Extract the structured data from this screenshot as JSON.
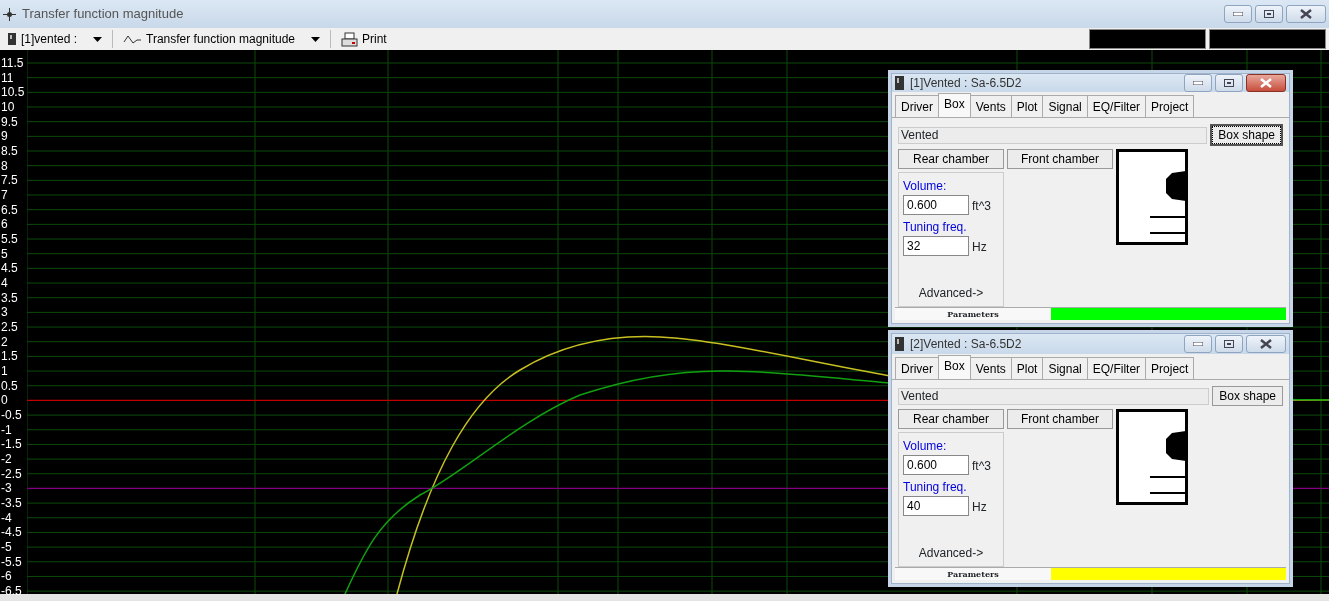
{
  "window": {
    "title": "Transfer function magnitude"
  },
  "toolbar": [
    {
      "kind": "dropdown",
      "label": "[1]vented :"
    },
    {
      "kind": "dropdown",
      "label": "Transfer function magnitude"
    },
    {
      "kind": "button",
      "label": "Print"
    }
  ],
  "plot": {
    "y_labels": [
      "11.5",
      "11",
      "10.5",
      "10",
      "9.5",
      "9",
      "8.5",
      "8",
      "7.5",
      "7",
      "6.5",
      "6",
      "5.5",
      "5",
      "4.5",
      "4",
      "3.5",
      "3",
      "2.5",
      "2",
      "1.5",
      "1",
      "0.5",
      "0",
      "-0.5",
      "-1",
      "-1.5",
      "-2",
      "-2.5",
      "-3",
      "-3.5",
      "-4",
      "-4.5",
      "-5",
      "-5.5",
      "-6",
      "-6.5"
    ]
  },
  "dialogs": [
    {
      "title": "[1]Vented : Sa-6.5D2",
      "active": true,
      "tabs": [
        {
          "label": "Driver",
          "selected": false
        },
        {
          "label": "Box",
          "selected": true
        },
        {
          "label": "Vents",
          "selected": false
        },
        {
          "label": "Plot",
          "selected": false
        },
        {
          "label": "Signal",
          "selected": false
        },
        {
          "label": "EQ/Filter",
          "selected": false
        },
        {
          "label": "Project",
          "selected": false
        }
      ],
      "box_type": "Vented",
      "box_shape": {
        "label": "Box shape",
        "focused": true
      },
      "chamber_buttons": [
        "Rear chamber",
        "Front chamber"
      ],
      "fields": [
        {
          "label": "Volume:",
          "value": "0.600",
          "unit": "ft^3"
        },
        {
          "label": "Tuning freq.",
          "value": "32",
          "unit": "Hz"
        }
      ],
      "advanced": "Advanced->",
      "status": {
        "label": "Parameters",
        "color": "#00ff00"
      }
    },
    {
      "title": "[2]Vented : Sa-6.5D2",
      "active": false,
      "tabs": [
        {
          "label": "Driver",
          "selected": false
        },
        {
          "label": "Box",
          "selected": true
        },
        {
          "label": "Vents",
          "selected": false
        },
        {
          "label": "Plot",
          "selected": false
        },
        {
          "label": "Signal",
          "selected": false
        },
        {
          "label": "EQ/Filter",
          "selected": false
        },
        {
          "label": "Project",
          "selected": false
        }
      ],
      "box_type": "Vented",
      "box_shape": {
        "label": "Box shape",
        "focused": false
      },
      "chamber_buttons": [
        "Rear chamber",
        "Front chamber"
      ],
      "fields": [
        {
          "label": "Volume:",
          "value": "0.600",
          "unit": "ft^3"
        },
        {
          "label": "Tuning freq.",
          "value": "40",
          "unit": "Hz"
        }
      ],
      "advanced": "Advanced->",
      "status": {
        "label": "Parameters",
        "color": "#ffff00"
      }
    }
  ]
}
